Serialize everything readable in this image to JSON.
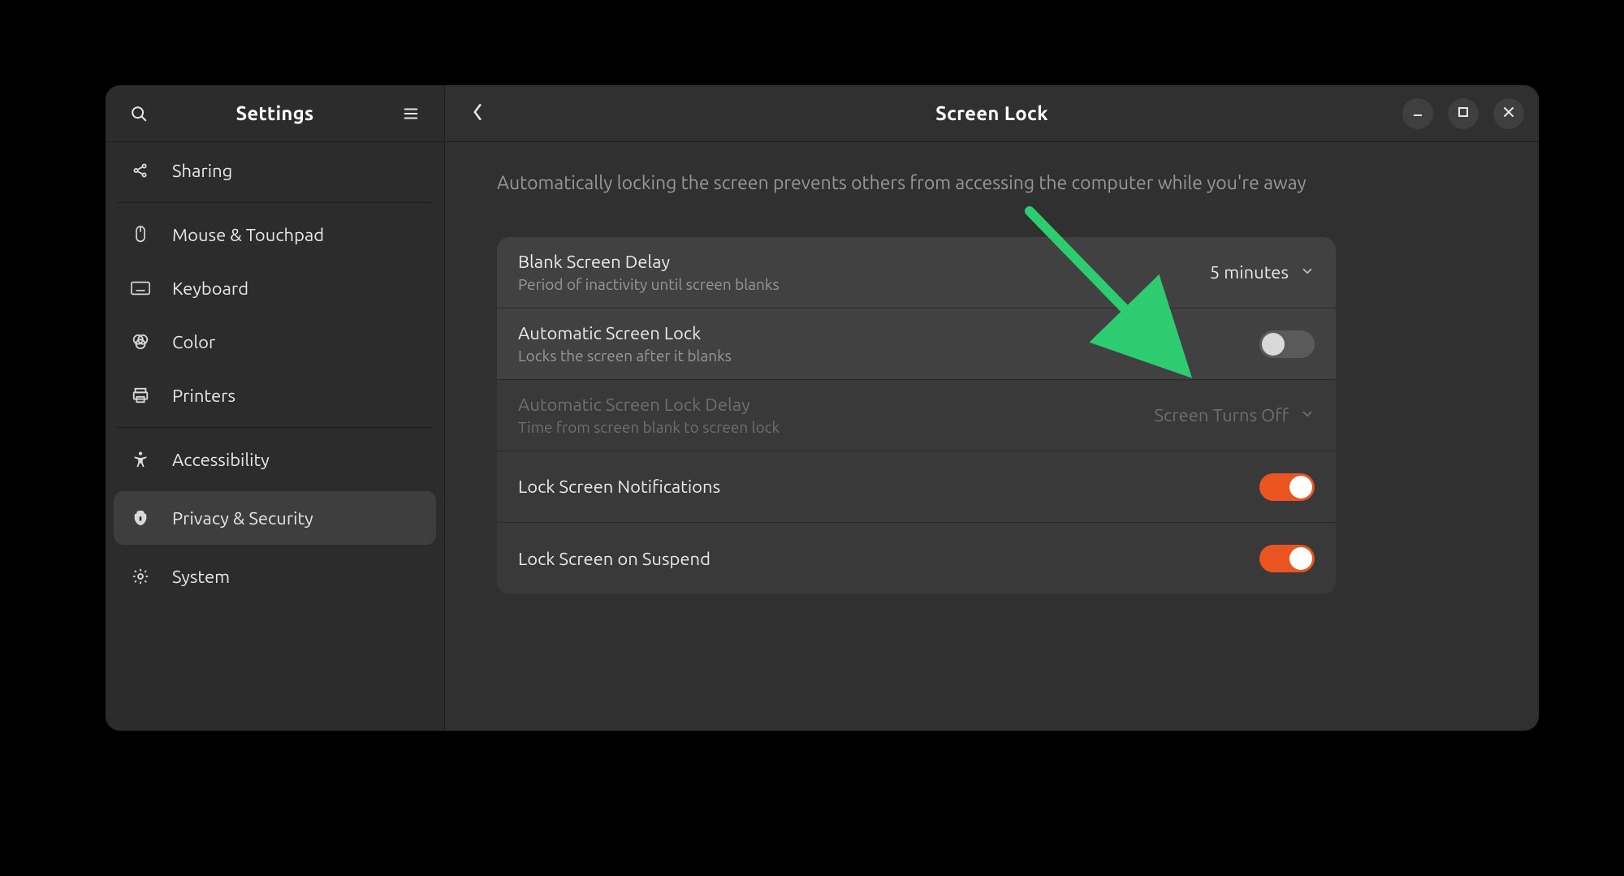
{
  "colors": {
    "accent": "#E95420",
    "annotation_arrow": "#2ECC71"
  },
  "sidebar": {
    "title": "Settings",
    "items": [
      {
        "id": "sharing",
        "label": "Sharing",
        "icon": "share-icon"
      },
      {
        "id": "mouse",
        "label": "Mouse & Touchpad",
        "icon": "mouse-icon"
      },
      {
        "id": "keyboard",
        "label": "Keyboard",
        "icon": "keyboard-icon"
      },
      {
        "id": "color",
        "label": "Color",
        "icon": "color-icon"
      },
      {
        "id": "printers",
        "label": "Printers",
        "icon": "printer-icon"
      },
      {
        "id": "accessibility",
        "label": "Accessibility",
        "icon": "accessibility-icon"
      },
      {
        "id": "privacy",
        "label": "Privacy & Security",
        "icon": "privacy-icon",
        "selected": true
      },
      {
        "id": "system",
        "label": "System",
        "icon": "gear-icon"
      }
    ]
  },
  "header": {
    "title": "Screen Lock"
  },
  "description": "Automatically locking the screen prevents others from accessing the computer while you're away",
  "rows": {
    "blank_delay": {
      "title": "Blank Screen Delay",
      "subtitle": "Period of inactivity until screen blanks",
      "value": "5 minutes"
    },
    "auto_lock": {
      "title": "Automatic Screen Lock",
      "subtitle": "Locks the screen after it blanks",
      "on": false
    },
    "auto_lock_delay": {
      "title": "Automatic Screen Lock Delay",
      "subtitle": "Time from screen blank to screen lock",
      "value": "Screen Turns Off",
      "disabled": true
    },
    "notifications": {
      "title": "Lock Screen Notifications",
      "on": true
    },
    "suspend": {
      "title": "Lock Screen on Suspend",
      "on": true
    }
  }
}
